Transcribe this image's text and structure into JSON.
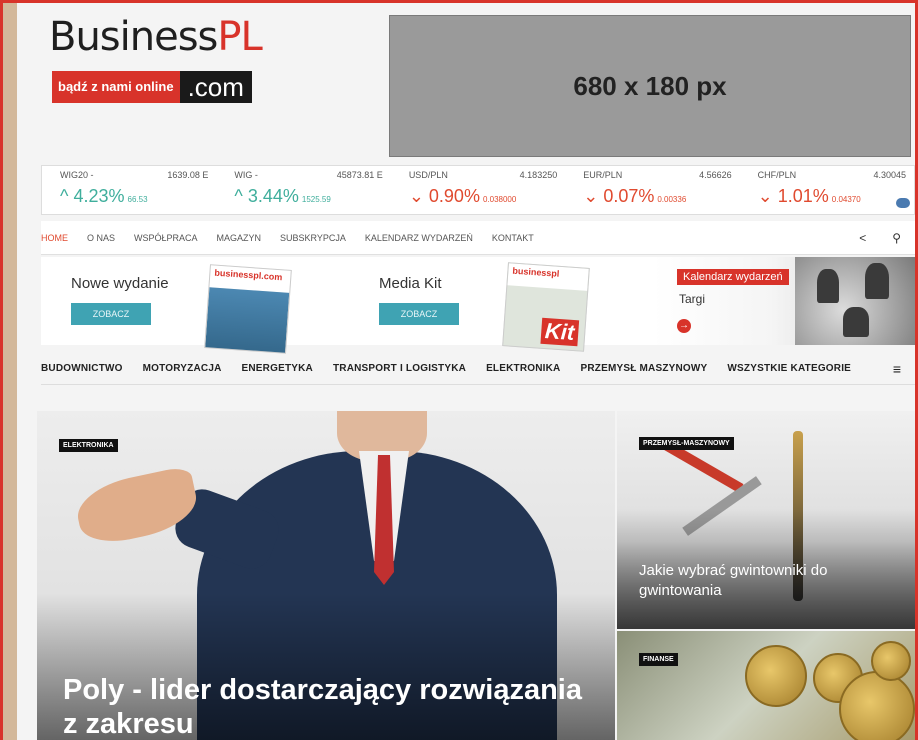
{
  "logo": {
    "word_main": "Business",
    "word_accent": "PL",
    "tag_left": "bądź z nami online",
    "tag_right": ".com"
  },
  "ad": {
    "label": "680 x 180 px"
  },
  "ticker": [
    {
      "name": "WIG20 -",
      "value": "1639.08 E",
      "change": "4.23%",
      "delta": "66.53",
      "dir": "up"
    },
    {
      "name": "WIG -",
      "value": "45873.81 E",
      "change": "3.44%",
      "delta": "1525.59",
      "dir": "up"
    },
    {
      "name": "USD/PLN",
      "value": "4.183250",
      "change": "0.90%",
      "delta": "0.038000",
      "dir": "down"
    },
    {
      "name": "EUR/PLN",
      "value": "4.56626",
      "change": "0.07%",
      "delta": "0.00336",
      "dir": "down"
    },
    {
      "name": "CHF/PLN",
      "value": "4.30045",
      "change": "1.01%",
      "delta": "0.04370",
      "dir": "down"
    }
  ],
  "topnav": [
    "HOME",
    "O NAS",
    "WSPÓŁPRACA",
    "MAGAZYN",
    "SUBSKRYPCJA",
    "KALENDARZ WYDARZEŃ",
    "KONTAKT"
  ],
  "promo": {
    "new_issue_title": "Nowe wydanie",
    "new_issue_btn": "ZOBACZ",
    "mag_logo": "businesspl.com",
    "mediakit_title": "Media Kit",
    "mediakit_btn": "ZOBACZ",
    "kit_mag_logo": "businesspl",
    "kit_label": "Kit",
    "calendar_badge": "Kalendarz wydarzeń",
    "calendar_sub": "Targi"
  },
  "catnav": [
    "BUDOWNICTWO",
    "MOTORYZACJA",
    "ENERGETYKA",
    "TRANSPORT I LOGISTYKA",
    "ELEKTRONIKA",
    "PRZEMYSŁ MASZYNOWY",
    "WSZYSTKIE KATEGORIE"
  ],
  "hero": {
    "category": "ELEKTRONIKA",
    "title": "Poly - lider dostarczający rozwiązania z zakresu"
  },
  "tile1": {
    "category": "PRZEMYSŁ-MASZYNOWY",
    "title": "Jakie wybrać gwintowniki do gwintowania"
  },
  "tile2": {
    "category": "FINANSE"
  },
  "colors": {
    "accent": "#d8332a",
    "up": "#3fae9c",
    "down": "#e04a2f",
    "button": "#3fa3b3"
  }
}
